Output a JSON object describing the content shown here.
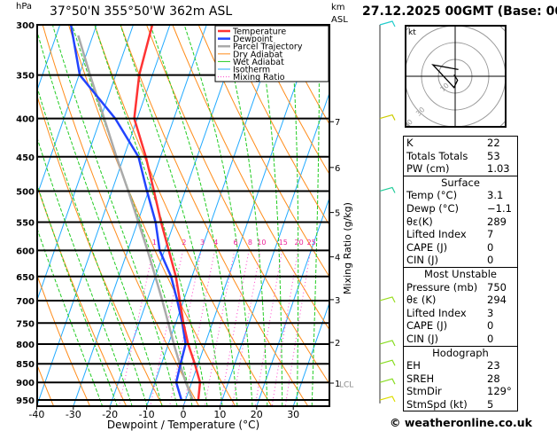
{
  "header": {
    "location": "37°50'N  355°50'W  362m  ASL",
    "datetime": "27.12.2025  00GMT  (Base: 00)",
    "pressure_unit": "hPa",
    "height_unit_1": "km",
    "height_unit_2": "ASL"
  },
  "chart_data": {
    "type": "skew-t",
    "xlabel": "Dewpoint / Temperature (°C)",
    "ylabel": "hPa",
    "y2label": "Mixing Ratio (g/kg)",
    "xlim": [
      -40,
      40
    ],
    "ylim": [
      300,
      968
    ],
    "y_scale": "log",
    "x_ticks": [
      -40,
      -30,
      -20,
      -10,
      0,
      10,
      20,
      30
    ],
    "y_ticks": [
      300,
      350,
      400,
      450,
      500,
      550,
      600,
      650,
      700,
      750,
      800,
      850,
      900,
      950
    ],
    "km_ticks": [
      {
        "km": "1",
        "p": 902
      },
      {
        "km": "2",
        "p": 796
      },
      {
        "km": "3",
        "p": 698
      },
      {
        "km": "4",
        "p": 612
      },
      {
        "km": "5",
        "p": 534
      },
      {
        "km": "6",
        "p": 465
      },
      {
        "km": "7",
        "p": 404
      }
    ],
    "lcl_label": "LCL",
    "lcl_p": 898,
    "mixing_ratio_labels": [
      1,
      2,
      3,
      4,
      6,
      8,
      10,
      15,
      20,
      25
    ],
    "mixing_ratio_label_p": 590,
    "legend": {
      "placement": "top-right",
      "entries": [
        {
          "name": "Temperature",
          "color": "#ff3333"
        },
        {
          "name": "Dewpoint",
          "color": "#2244ff"
        },
        {
          "name": "Parcel Trajectory",
          "color": "#aaaaaa"
        },
        {
          "name": "Dry Adiabat",
          "color": "#ff8c1a"
        },
        {
          "name": "Wet Adiabat",
          "color": "#22cc22"
        },
        {
          "name": "Isotherm",
          "color": "#22aaff"
        },
        {
          "name": "Mixing Ratio",
          "color": "#ff44cc"
        }
      ]
    },
    "series": [
      {
        "name": "Temperature",
        "p": [
          950,
          900,
          850,
          800,
          750,
          700,
          650,
          600,
          550,
          500,
          450,
          400,
          350,
          300
        ],
        "t": [
          3.5,
          2.3,
          -0.9,
          -4.6,
          -7.9,
          -11,
          -14.4,
          -18.8,
          -23.6,
          -28.5,
          -34,
          -40.8,
          -43.6,
          -44.8
        ]
      },
      {
        "name": "Dewpoint",
        "p": [
          950,
          900,
          850,
          800,
          750,
          700,
          650,
          600,
          550,
          500,
          450,
          400,
          350,
          300
        ],
        "t": [
          -1.1,
          -4.2,
          -4.8,
          -5.3,
          -8.2,
          -11.7,
          -15.7,
          -21.3,
          -25.1,
          -30.4,
          -36,
          -46,
          -59.8,
          -67
        ]
      },
      {
        "name": "Parcel Trajectory",
        "p": [
          950,
          900,
          850,
          800,
          750,
          700,
          650,
          600,
          550,
          500,
          450,
          400,
          350,
          310
        ],
        "t": [
          2,
          -1.6,
          -5,
          -8.5,
          -12,
          -15.8,
          -20,
          -24.6,
          -29.8,
          -35.5,
          -42,
          -49,
          -57,
          -64
        ]
      }
    ],
    "hodograph": {
      "unit": "kt",
      "rings": [
        10,
        20,
        30,
        40
      ],
      "ring_labels": [
        "10",
        "30",
        "40"
      ],
      "u": [
        -0.7,
        1.4,
        -0.7,
        -13.2,
        1.9
      ],
      "v": [
        0.9,
        -2.3,
        -6.7,
        6.8,
        4
      ]
    },
    "wind_barbs": [
      {
        "p": 950,
        "color": "#dddd00"
      },
      {
        "p": 900,
        "color": "#88dd22"
      },
      {
        "p": 850,
        "color": "#88dd22"
      },
      {
        "p": 800,
        "color": "#88dd22"
      },
      {
        "p": 700,
        "color": "#99dd22"
      },
      {
        "p": 500,
        "color": "#22cc99"
      },
      {
        "p": 400,
        "color": "#cccc00"
      },
      {
        "p": 300,
        "color": "#22cccc"
      }
    ]
  },
  "table": {
    "indices": [
      {
        "label": "K",
        "value": "22"
      },
      {
        "label": "Totals Totals",
        "value": "53"
      },
      {
        "label": "PW (cm)",
        "value": "1.03"
      }
    ],
    "surface": {
      "title": "Surface",
      "rows": [
        {
          "label": "Temp (°C)",
          "value": "3.1"
        },
        {
          "label": "Dewp (°C)",
          "value": "−1.1"
        },
        {
          "label": "θε(K)",
          "value": "289"
        },
        {
          "label": "Lifted Index",
          "value": "7"
        },
        {
          "label": "CAPE (J)",
          "value": "0"
        },
        {
          "label": "CIN (J)",
          "value": "0"
        }
      ]
    },
    "most_unstable": {
      "title": "Most Unstable",
      "rows": [
        {
          "label": "Pressure (mb)",
          "value": "750"
        },
        {
          "label": "θε (K)",
          "value": "294"
        },
        {
          "label": "Lifted Index",
          "value": "3"
        },
        {
          "label": "CAPE (J)",
          "value": "0"
        },
        {
          "label": "CIN (J)",
          "value": "0"
        }
      ]
    },
    "hodograph": {
      "title": "Hodograph",
      "rows": [
        {
          "label": "EH",
          "value": "23"
        },
        {
          "label": "SREH",
          "value": "28"
        },
        {
          "label": "StmDir",
          "value": "129°"
        },
        {
          "label": "StmSpd (kt)",
          "value": "5"
        }
      ]
    }
  },
  "footer": {
    "credit": "© weatheronline.co.uk"
  }
}
